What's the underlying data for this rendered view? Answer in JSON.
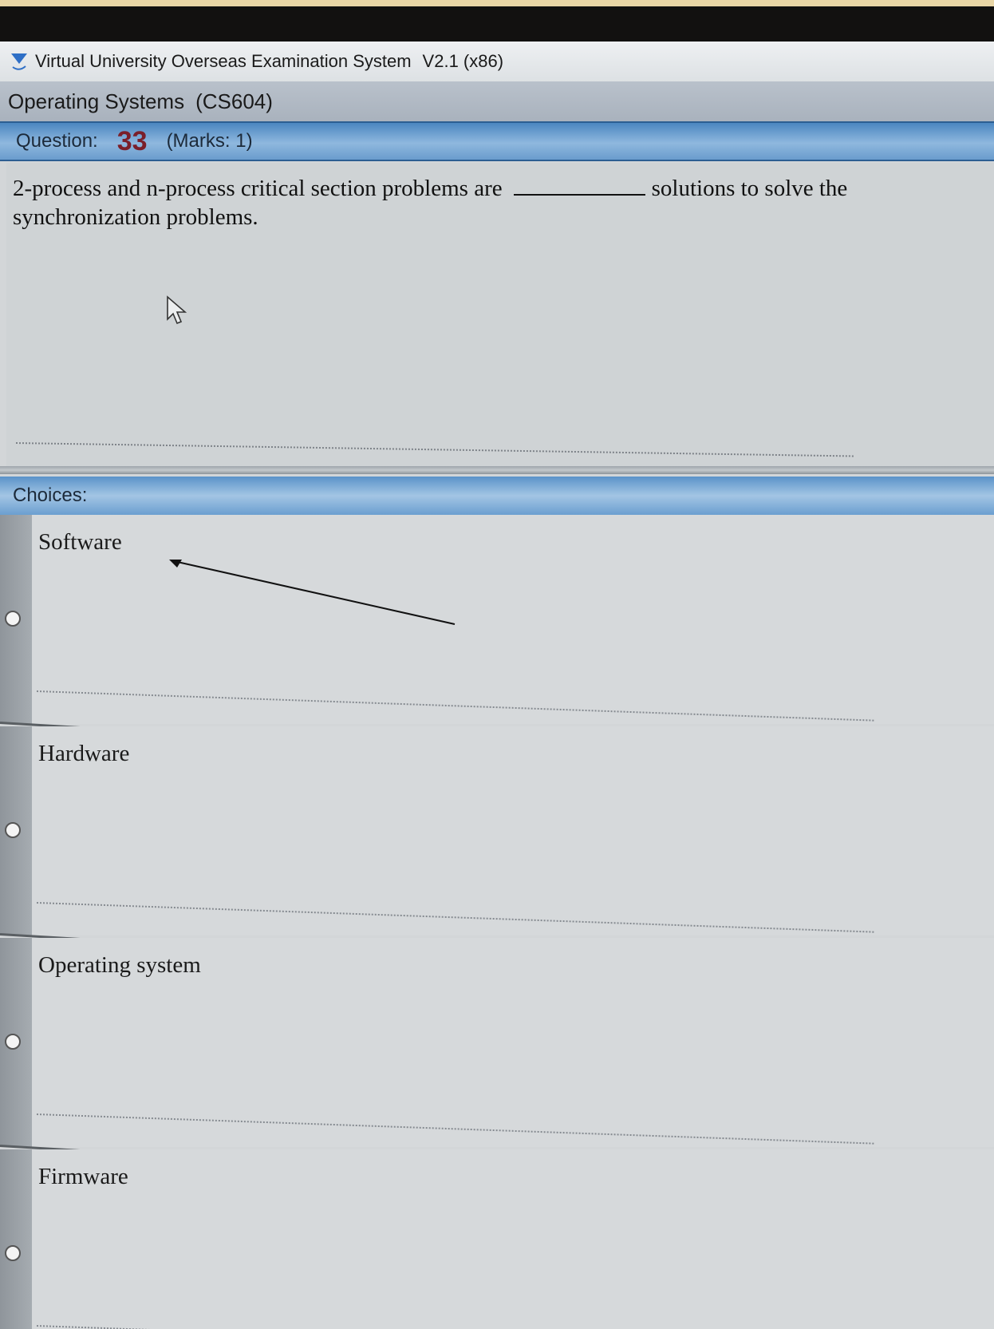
{
  "window": {
    "title": "Virtual University Overseas Examination System",
    "version": "V2.1 (x86)",
    "icon": "vu-logo-icon"
  },
  "course": {
    "name": "Operating Systems",
    "code": "(CS604)"
  },
  "question": {
    "label": "Question:",
    "number": "33",
    "marks": "(Marks: 1)",
    "text_before_blank": "2-process and n-process critical section problems are",
    "text_after_blank": "solutions to solve the synchronization problems."
  },
  "choices": {
    "header": "Choices:",
    "options": [
      {
        "label": "Software",
        "selected": false
      },
      {
        "label": "Hardware",
        "selected": false
      },
      {
        "label": "Operating system",
        "selected": false
      },
      {
        "label": "Firmware",
        "selected": false
      }
    ]
  },
  "colors": {
    "header_blue": "#4b86c0",
    "question_number": "#7a1f2a",
    "background": "#d3d6d8"
  }
}
